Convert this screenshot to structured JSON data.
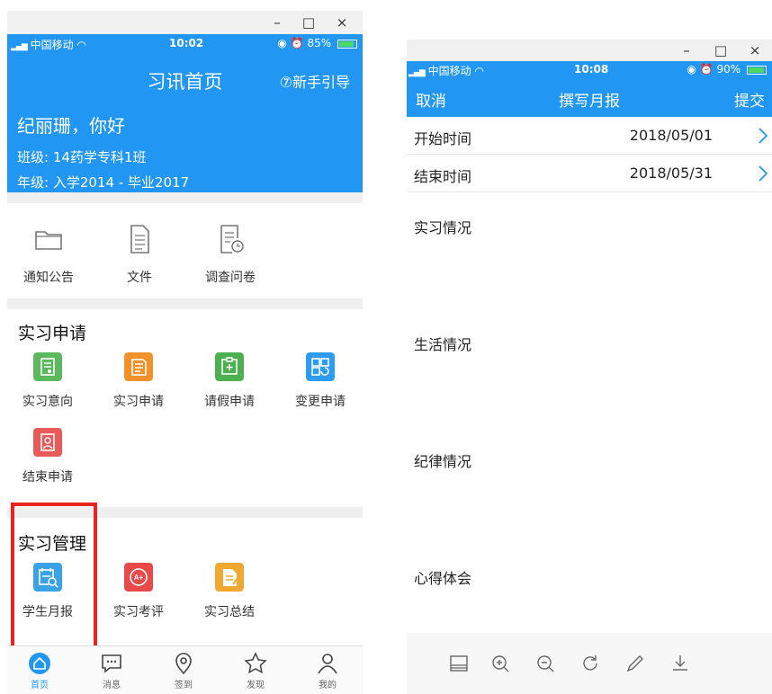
{
  "colors": {
    "primary": "#2196f3",
    "highlight": "#e8231f"
  },
  "left": {
    "window_controls": [
      "–",
      "□",
      "×"
    ],
    "status": {
      "carrier": "中国移动",
      "time": "10:02",
      "battery": "85%"
    },
    "header": {
      "title": "习讯首页",
      "guide": "⑦新手引导",
      "greeting": "纪丽珊，你好",
      "class": "班级: 14药学专科1班",
      "grade": "年级: 入学2014 - 毕业2017"
    },
    "tools": [
      {
        "label": "通知公告",
        "icon": "folder-icon"
      },
      {
        "label": "文件",
        "icon": "file-icon"
      },
      {
        "label": "调查问卷",
        "icon": "survey-icon"
      }
    ],
    "apply_section": {
      "title": "实习申请",
      "items": [
        {
          "label": "实习意向",
          "icon": "intention-icon",
          "color": "#5cb85c"
        },
        {
          "label": "实习申请",
          "icon": "application-icon",
          "color": "#f0922b"
        },
        {
          "label": "请假申请",
          "icon": "leave-icon",
          "color": "#4caf50"
        },
        {
          "label": "变更申请",
          "icon": "change-icon",
          "color": "#2d9cf0"
        },
        {
          "label": "结束申请",
          "icon": "end-icon",
          "color": "#e85a5a"
        }
      ]
    },
    "manage_section": {
      "title": "实习管理",
      "items": [
        {
          "label": "学生月报",
          "icon": "monthly-report-icon",
          "color": "#3aa3e8"
        },
        {
          "label": "实习考评",
          "icon": "evaluation-icon",
          "color": "#e84a4a"
        },
        {
          "label": "实习总结",
          "icon": "summary-icon",
          "color": "#f0a830"
        }
      ]
    },
    "tabs": [
      {
        "label": "首页",
        "icon": "home-icon"
      },
      {
        "label": "消息",
        "icon": "message-icon"
      },
      {
        "label": "签到",
        "icon": "location-icon"
      },
      {
        "label": "发现",
        "icon": "star-icon"
      },
      {
        "label": "我的",
        "icon": "profile-icon"
      }
    ]
  },
  "right": {
    "window_controls": [
      "–",
      "□",
      "×"
    ],
    "status": {
      "carrier": "中国移动",
      "time": "10:08",
      "battery": "90%"
    },
    "nav": {
      "cancel": "取消",
      "title": "撰写月报",
      "submit": "提交"
    },
    "start": {
      "label": "开始时间",
      "value": "2018/05/01"
    },
    "end": {
      "label": "结束时间",
      "value": "2018/05/31"
    },
    "sections": [
      "实习情况",
      "生活情况",
      "纪律情况",
      "心得体会"
    ],
    "toolbar_icons": [
      "layout-icon",
      "zoom-in-icon",
      "zoom-out-icon",
      "rotate-icon",
      "pen-icon",
      "download-icon"
    ]
  }
}
